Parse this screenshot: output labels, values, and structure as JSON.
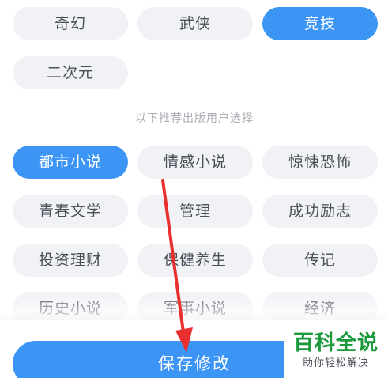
{
  "genres_top": {
    "row1": [
      "奇幻",
      "武侠",
      "竞技"
    ],
    "row2": [
      "二次元"
    ]
  },
  "divider_label": "以下推荐出版用户选择",
  "genres_publish": {
    "row1": [
      "都市小说",
      "情感小说",
      "惊悚恐怖"
    ],
    "row2": [
      "青春文学",
      "管理",
      "成功励志"
    ],
    "row3": [
      "投资理财",
      "保健养生",
      "传记"
    ],
    "row4": [
      "历史小说",
      "军事小说",
      "经济"
    ]
  },
  "selected": [
    "竞技",
    "都市小说"
  ],
  "save_button_label": "保存修改",
  "watermark": {
    "title": "百科全说",
    "subtitle": "助你轻松解决"
  },
  "colors": {
    "accent": "#3c95f4",
    "chip_bg": "#f1f2f6",
    "chip_text": "#4b4f58",
    "annotation_arrow": "#e8312f",
    "watermark_green": "#1a9a3a"
  },
  "icons": {
    "annotation": "red-arrow-annotation"
  }
}
